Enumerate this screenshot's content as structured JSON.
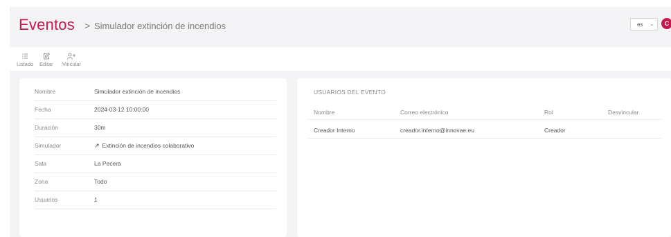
{
  "header": {
    "title": "Eventos",
    "separator": ">",
    "subtitle": "Simulador extinción de incendios",
    "language": "es",
    "avatar_initial": "C"
  },
  "toolbar": {
    "items": [
      {
        "label": "Listado",
        "icon": "list-icon"
      },
      {
        "label": "Editar",
        "icon": "edit-icon"
      },
      {
        "label": "Vincular",
        "icon": "add-user-icon"
      }
    ]
  },
  "details": {
    "rows": [
      {
        "label": "Nombre",
        "value": "Simulador extinción de incendios"
      },
      {
        "label": "Fecha",
        "value": "2024-03-12 10:00:00"
      },
      {
        "label": "Duración",
        "value": "30m"
      },
      {
        "label": "Simulador",
        "value": "Extinción de incendios colaborativo",
        "icon": "external-link-arrow-icon"
      },
      {
        "label": "Sala",
        "value": "La Pecera"
      },
      {
        "label": "Zona",
        "value": "Todo"
      },
      {
        "label": "Usuarios",
        "value": "1"
      }
    ]
  },
  "users": {
    "section_title": "USUARIOS DEL EVENTO",
    "columns": [
      "Nombre",
      "Correo electrónico",
      "Rol",
      "Desvincular"
    ],
    "rows": [
      {
        "name": "Creador Interno",
        "email": "creador.interno@innovae.eu",
        "role": "Creador"
      }
    ]
  },
  "colors": {
    "brand": "#c8174d",
    "background": "#f3f3f5",
    "panel": "#ffffff",
    "muted_text": "#8a8a8a"
  }
}
